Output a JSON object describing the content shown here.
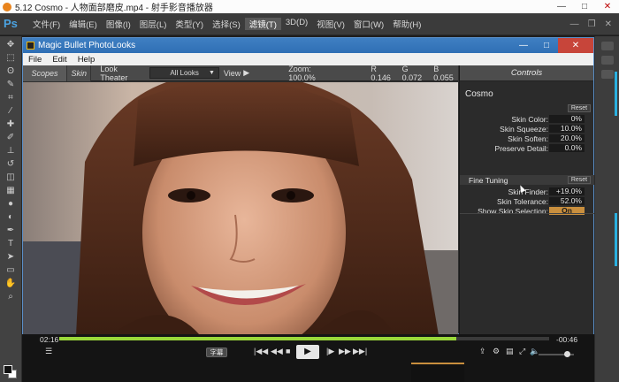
{
  "player_window": {
    "title": "5.12 Cosmo - 人物面部磨皮.mp4 - 射手影音播放器",
    "controls": [
      "—",
      "□",
      "✕"
    ]
  },
  "photoshop": {
    "logo": "Ps",
    "menu": [
      {
        "label": "文件(F)"
      },
      {
        "label": "编辑(E)"
      },
      {
        "label": "图像(I)"
      },
      {
        "label": "图层(L)"
      },
      {
        "label": "类型(Y)"
      },
      {
        "label": "选择(S)"
      },
      {
        "label": "滤镜(T)",
        "active": true
      },
      {
        "label": "3D(D)"
      },
      {
        "label": "视图(V)"
      },
      {
        "label": "窗口(W)"
      },
      {
        "label": "帮助(H)"
      }
    ]
  },
  "plugin": {
    "title": "Magic Bullet PhotoLooks",
    "menu": [
      "File",
      "Edit",
      "Help"
    ],
    "tabs": {
      "scopes": "Scopes",
      "skin": "Skin"
    },
    "look_theater_label": "Look Theater",
    "look_select": "All Looks",
    "view_label": "View",
    "zoom": "Zoom:  100.0%",
    "rgb": {
      "r": "R  0.146",
      "g": "G  0.072",
      "b": "B  0.055"
    },
    "controls": {
      "header": "Controls",
      "section": "Cosmo",
      "reset": "Reset",
      "params": [
        {
          "label": "Skin Color:",
          "value": "0%"
        },
        {
          "label": "Skin Squeeze:",
          "value": "10.0%"
        },
        {
          "label": "Skin Soften:",
          "value": "20.0%"
        },
        {
          "label": "Preserve Detail:",
          "value": "0.0%"
        }
      ],
      "fine_tuning": {
        "title": "Fine Tuning",
        "reset": "Reset",
        "params": [
          {
            "label": "Skin Finder:",
            "value": "+19.0%"
          },
          {
            "label": "Skin Tolerance:",
            "value": "52.0%"
          },
          {
            "label": "Show Skin Selection:",
            "value": "On"
          }
        ]
      }
    }
  },
  "playback": {
    "elapsed": "02:16",
    "remaining": "-00:46",
    "progress": 0.81,
    "subtitle_label": "字幕",
    "volume": 0.8
  },
  "colors": {
    "progress_fill": "#9ad83a",
    "toggle_on": "#c98f3e",
    "title_bar": "#3f7fc2"
  }
}
